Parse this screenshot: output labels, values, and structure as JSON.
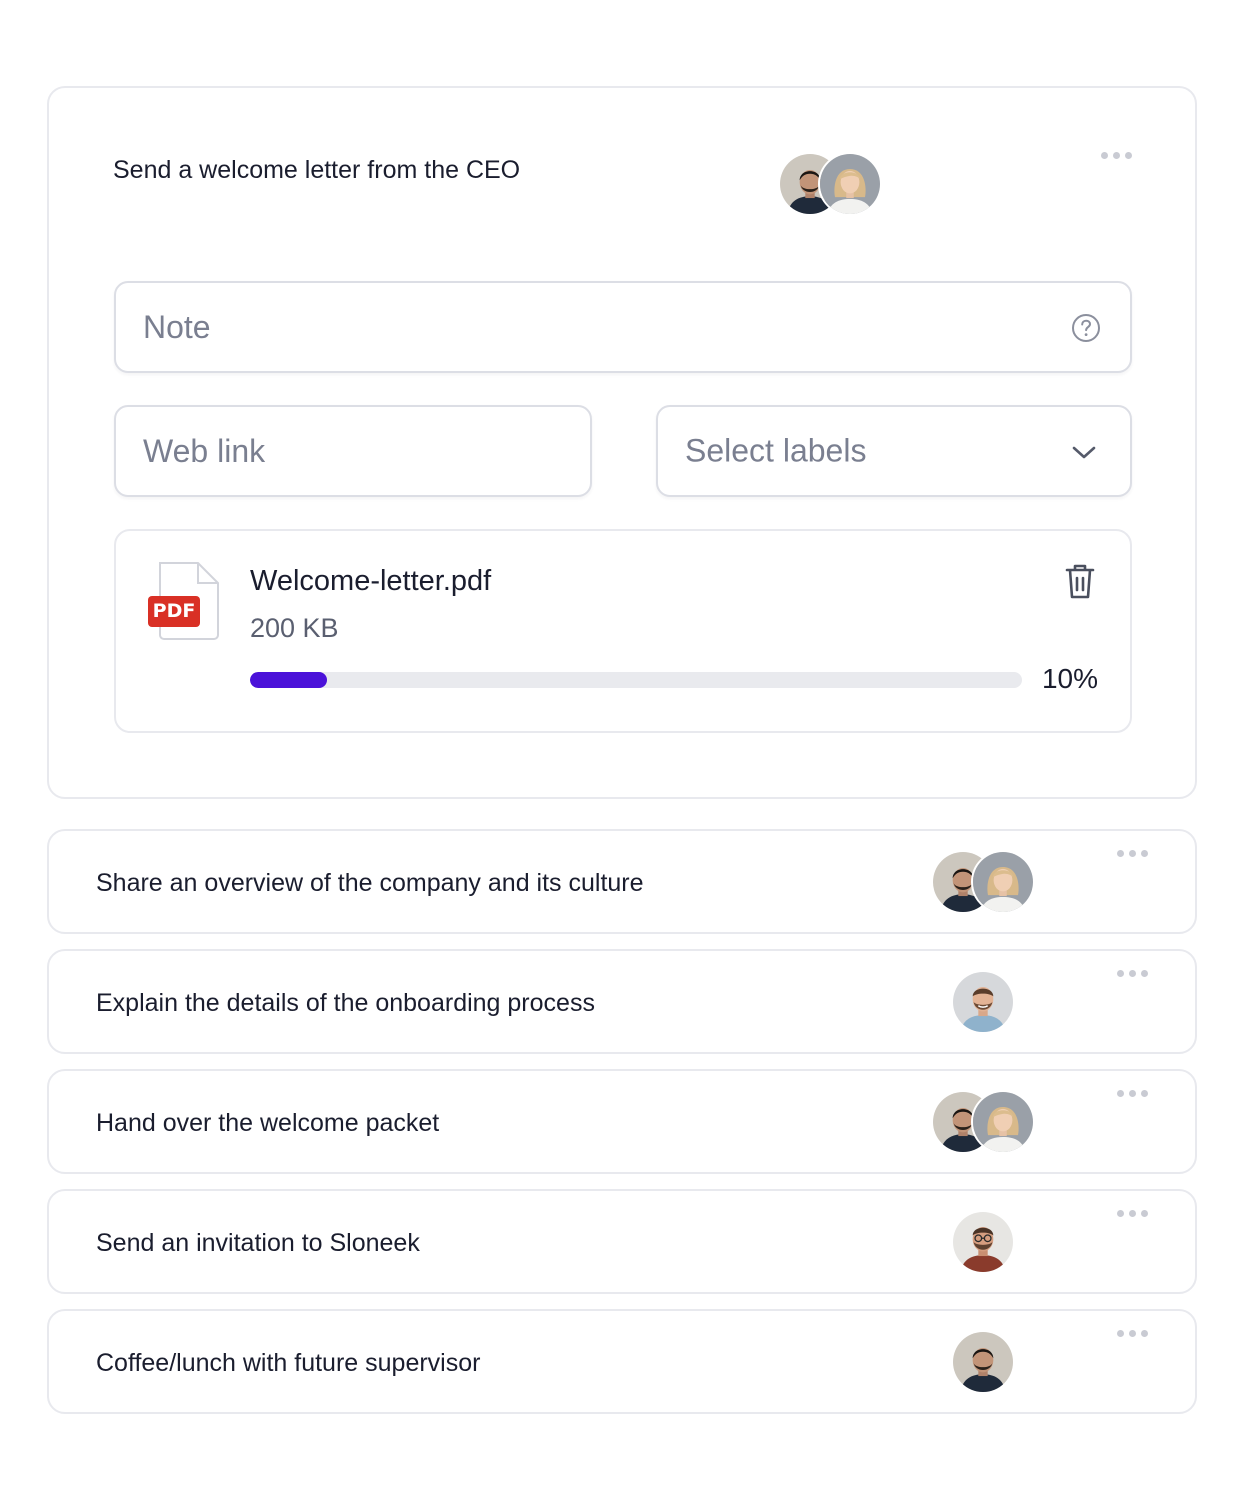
{
  "expanded_task": {
    "title": "Send a welcome letter from the CEO",
    "assignees": [
      "man-dark-hair",
      "woman-blonde"
    ],
    "note": {
      "placeholder": "Note",
      "icon": "help-circle-icon"
    },
    "web_link": {
      "placeholder": "Web link"
    },
    "labels_select": {
      "placeholder": "Select labels",
      "icon": "chevron-down-icon"
    },
    "attachment": {
      "file_name": "Welcome-letter.pdf",
      "file_type": "PDF",
      "file_size": "200 KB",
      "progress_percent": 10,
      "progress_label": "10%",
      "delete_icon": "trash-icon"
    }
  },
  "tasks": [
    {
      "title": "Share an overview of the company and its culture",
      "assignees": [
        "man-dark-hair",
        "woman-blonde"
      ]
    },
    {
      "title": "Explain the details of the onboarding process",
      "assignees": [
        "man-bearded-smiling"
      ]
    },
    {
      "title": "Hand over the welcome packet",
      "assignees": [
        "man-dark-hair",
        "woman-blonde"
      ]
    },
    {
      "title": "Send an invitation to Sloneek",
      "assignees": [
        "man-glasses-beard"
      ]
    },
    {
      "title": "Coffee/lunch with future supervisor",
      "assignees": [
        "man-dark-hair"
      ]
    }
  ],
  "colors": {
    "accent": "#4b12d9",
    "pdf_badge": "#d93025",
    "border": "#e8e9ee",
    "text": "#1a1d2e",
    "placeholder": "#7a7f90"
  }
}
